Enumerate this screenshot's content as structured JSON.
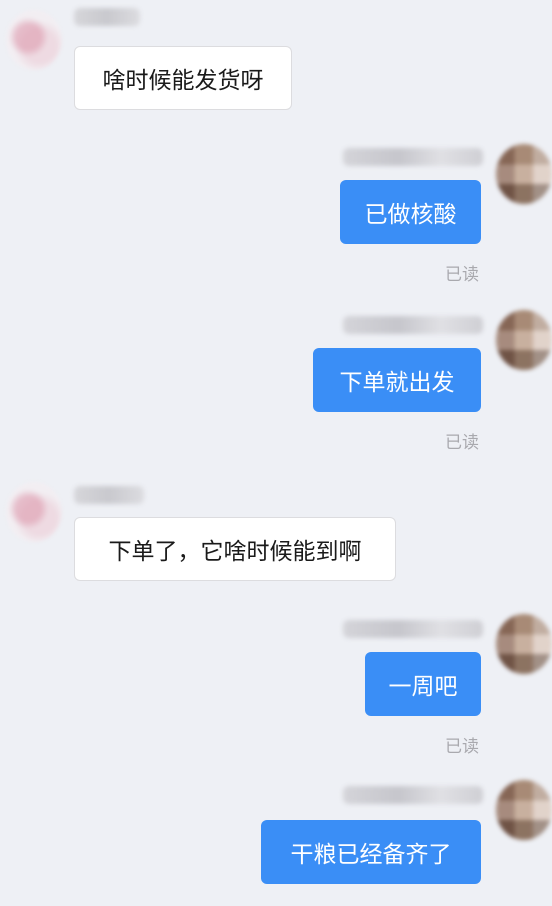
{
  "messages": [
    {
      "side": "left",
      "text": "啥时候能发货呀"
    },
    {
      "side": "right",
      "text": "已做核酸",
      "status": "已读"
    },
    {
      "side": "right",
      "text": "下单就出发",
      "status": "已读"
    },
    {
      "side": "left",
      "text": "下单了，它啥时候能到啊"
    },
    {
      "side": "right",
      "text": "一周吧",
      "status": "已读"
    },
    {
      "side": "right",
      "text": "干粮已经备齐了"
    }
  ],
  "colors": {
    "background": "#eef0f5",
    "sent_bubble": "#3a8ef6",
    "received_bubble": "#ffffff",
    "read_status": "#a9a9ae"
  }
}
